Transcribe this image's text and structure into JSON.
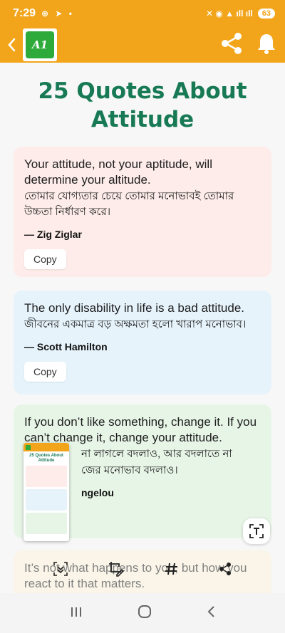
{
  "status_bar": {
    "time": "7:29",
    "left_icons": "⊕ ➤ •",
    "right_icons": "✕ ◉ ▲ ıll ıll",
    "battery": "63"
  },
  "app_bar": {
    "logo_text": "A1",
    "share_icon": "share-icon",
    "bell_icon": "bell-icon"
  },
  "page": {
    "title": "25 Quotes About Attitude"
  },
  "quotes": [
    {
      "english": "Your attitude, not your aptitude, will determine your altitude.",
      "bengali": "তোমার যোগ্যতার চেয়ে তোমার মনোভাবই তোমার উচ্চতা নির্ধারণ করে।",
      "author": "— Zig Ziglar",
      "copy_label": "Copy"
    },
    {
      "english": "The only disability in life is a bad attitude.",
      "bengali": "জীবনের একমাত্র বড় অক্ষমতা হলো খারাপ মনোভাব।",
      "author": "— Scott Hamilton",
      "copy_label": "Copy"
    },
    {
      "english": "If you don’t like something, change it. If you can’t change it, change your attitude.",
      "bengali_line1": "না লাগলে বদলাও, আর বদলাতে না",
      "bengali_line2": "জের মনোভাব বদলাও।",
      "author": "ngelou"
    },
    {
      "english": "It’s not what happens to you, but how you react to it that matters."
    }
  ],
  "colors": {
    "accent": "#f2a51a",
    "title": "#177a55",
    "card1": "#fdece9",
    "card2": "#e6f3fb",
    "card3": "#e7f5e7",
    "card4": "#fdf4dc"
  }
}
